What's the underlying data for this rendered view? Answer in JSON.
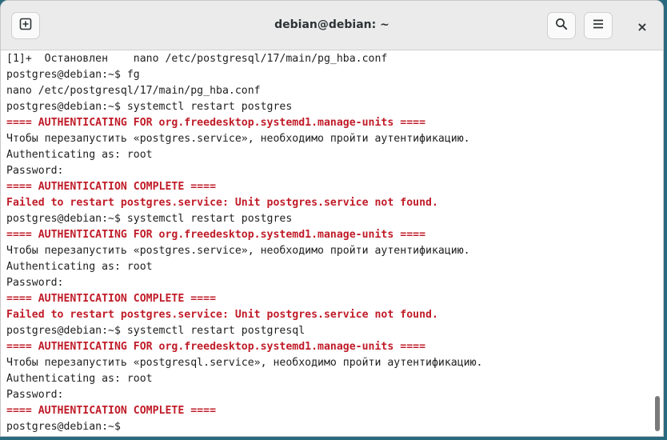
{
  "window": {
    "title": "debian@debian: ~",
    "close_glyph": "×"
  },
  "icons": {
    "new_tab": "new-tab-icon",
    "search": "search-icon",
    "menu": "hamburger-menu-icon",
    "close": "close-icon"
  },
  "colors": {
    "error_text": "#c01c28",
    "normal_text": "#1e1e1e",
    "background": "#ffffff"
  },
  "terminal": {
    "lines": [
      {
        "text": "[1]+  Остановлен    nano /etc/postgresql/17/main/pg_hba.conf",
        "style": "normal"
      },
      {
        "text": "postgres@debian:~$ fg",
        "style": "normal"
      },
      {
        "text": "nano /etc/postgresql/17/main/pg_hba.conf",
        "style": "normal"
      },
      {
        "text": "postgres@debian:~$ systemctl restart postgres",
        "style": "normal"
      },
      {
        "text": "==== AUTHENTICATING FOR org.freedesktop.systemd1.manage-units ====",
        "style": "red"
      },
      {
        "text": "Чтобы перезапустить «postgres.service», необходимо пройти аутентификацию.",
        "style": "normal"
      },
      {
        "text": "Authenticating as: root",
        "style": "normal"
      },
      {
        "text": "Password:",
        "style": "normal"
      },
      {
        "text": "==== AUTHENTICATION COMPLETE ====",
        "style": "red"
      },
      {
        "text": "Failed to restart postgres.service: Unit postgres.service not found.",
        "style": "red"
      },
      {
        "text": "postgres@debian:~$ systemctl restart postgres",
        "style": "normal"
      },
      {
        "text": "==== AUTHENTICATING FOR org.freedesktop.systemd1.manage-units ====",
        "style": "red"
      },
      {
        "text": "Чтобы перезапустить «postgres.service», необходимо пройти аутентификацию.",
        "style": "normal"
      },
      {
        "text": "Authenticating as: root",
        "style": "normal"
      },
      {
        "text": "Password:",
        "style": "normal"
      },
      {
        "text": "==== AUTHENTICATION COMPLETE ====",
        "style": "red"
      },
      {
        "text": "Failed to restart postgres.service: Unit postgres.service not found.",
        "style": "red"
      },
      {
        "text": "postgres@debian:~$ systemctl restart postgresql",
        "style": "normal"
      },
      {
        "text": "==== AUTHENTICATING FOR org.freedesktop.systemd1.manage-units ====",
        "style": "red"
      },
      {
        "text": "Чтобы перезапустить «postgresql.service», необходимо пройти аутентификацию.",
        "style": "normal"
      },
      {
        "text": "Authenticating as: root",
        "style": "normal"
      },
      {
        "text": "Password:",
        "style": "normal"
      },
      {
        "text": "==== AUTHENTICATION COMPLETE ====",
        "style": "red"
      },
      {
        "text": "postgres@debian:~$ ",
        "style": "normal"
      }
    ]
  }
}
